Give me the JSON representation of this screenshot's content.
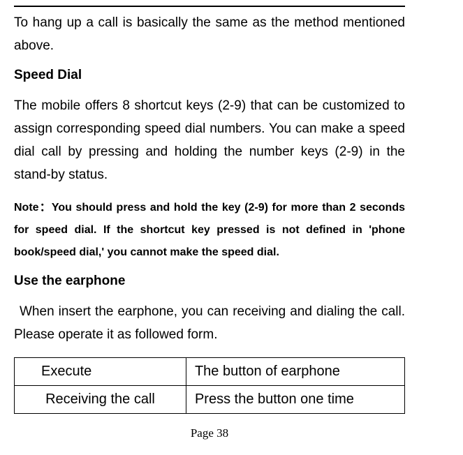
{
  "para1": "To hang up a call is basically the same as the method mentioned above.",
  "heading_speed_dial": "Speed Dial",
  "para2": "The mobile offers 8 shortcut keys (2-9) that can be customized to assign corresponding speed dial numbers. You can make a speed dial call by pressing and holding the number keys (2-9) in the stand-by status.",
  "note": "Note：You should press and hold the key (2-9) for more than 2 seconds for speed dial. If the shortcut key pressed is not defined in 'phone book/speed dial,' you cannot make the speed dial.",
  "heading_earphone": "Use the earphone",
  "para3": "When insert the earphone, you can receiving and dialing the call. Please operate it as followed form.",
  "table": {
    "header": {
      "col1": "Execute",
      "col2": "The button of earphone"
    },
    "row1": {
      "col1": "Receiving the call",
      "col2": "Press the button one time"
    }
  },
  "page_number": "Page 38"
}
